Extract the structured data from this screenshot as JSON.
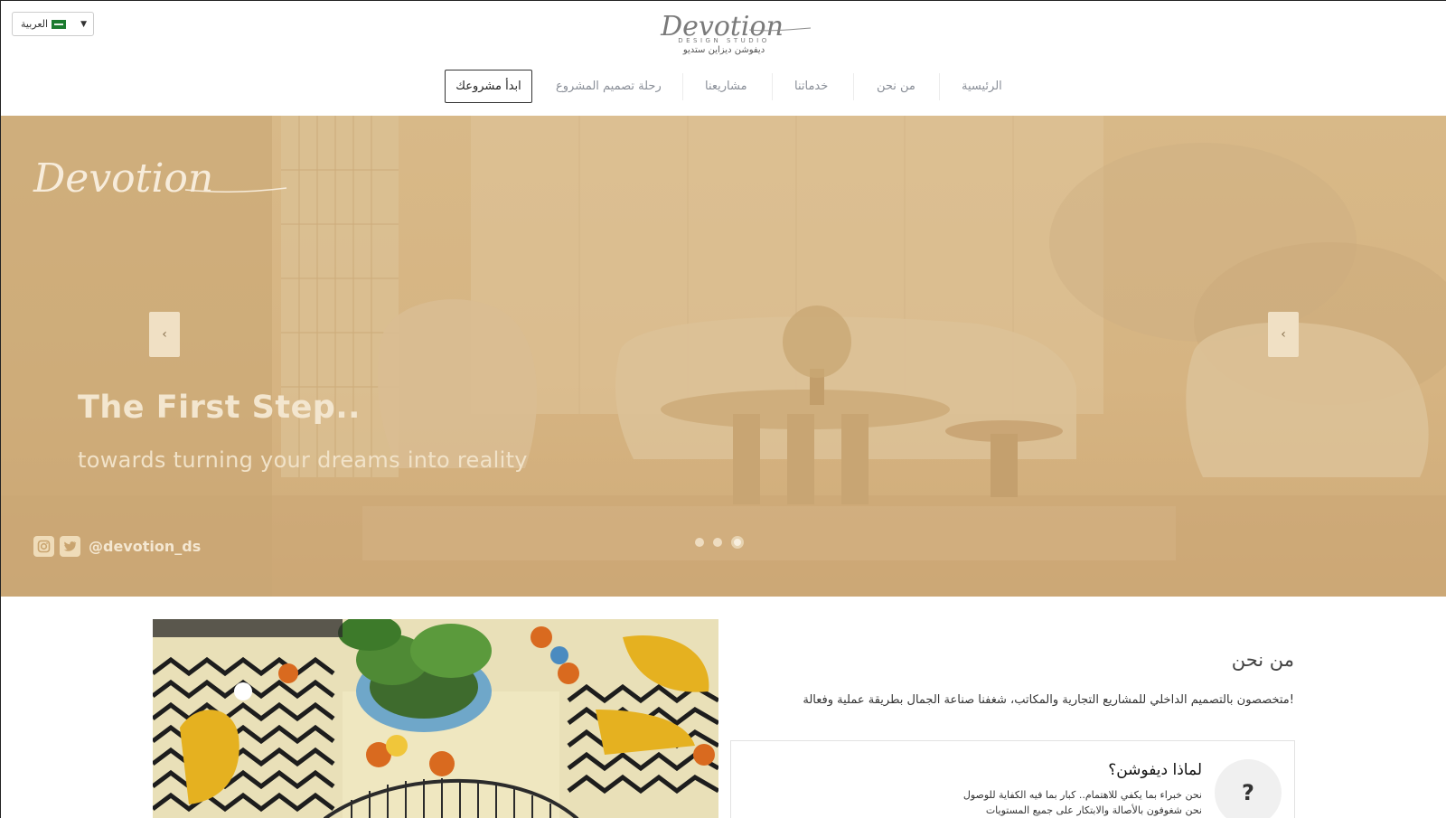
{
  "header": {
    "language": {
      "label": "العربية",
      "caret": "▼",
      "flag_icon": "saudi-flag-icon"
    },
    "logo": {
      "wordmark": "Devotion",
      "subtitle": "DESIGN STUDIO",
      "arabic_name": "ديفوشن ديزاين ستديو"
    },
    "nav": [
      {
        "label": "الرئيسية"
      },
      {
        "label": "من نحن"
      },
      {
        "label": "خدماتنا"
      },
      {
        "label": "مشاريعنا"
      },
      {
        "label": "رحلة تصميم المشروع"
      }
    ],
    "cta_label": "ابدأ مشروعك"
  },
  "hero": {
    "brand": "Devotion",
    "title": "The First Step..",
    "subtitle": "towards turning your dreams into reality",
    "handle": "@devotion_ds",
    "social_icons": [
      "instagram-icon",
      "twitter-icon"
    ],
    "prev_arrow": "‹",
    "next_arrow": "‹",
    "slides_count": 3,
    "active_slide": 1,
    "tint_color": "#d6b482"
  },
  "about": {
    "title": "من نحن",
    "description": "متخصصون بالتصميم الداخلي للمشاريع التجارية والمكاتب، شغفنا صناعة الجمال بطريقة عملية وفعالة!",
    "why": {
      "icon": "?",
      "title": "لماذا ديفوشن؟",
      "line1": "نحن خبراء بما يكفي للاهتمام.. كبار بما فيه الكفاية للوصول",
      "line2": "نحن شغوفون بالأصالة والابتكار على جميع المستويات"
    }
  }
}
